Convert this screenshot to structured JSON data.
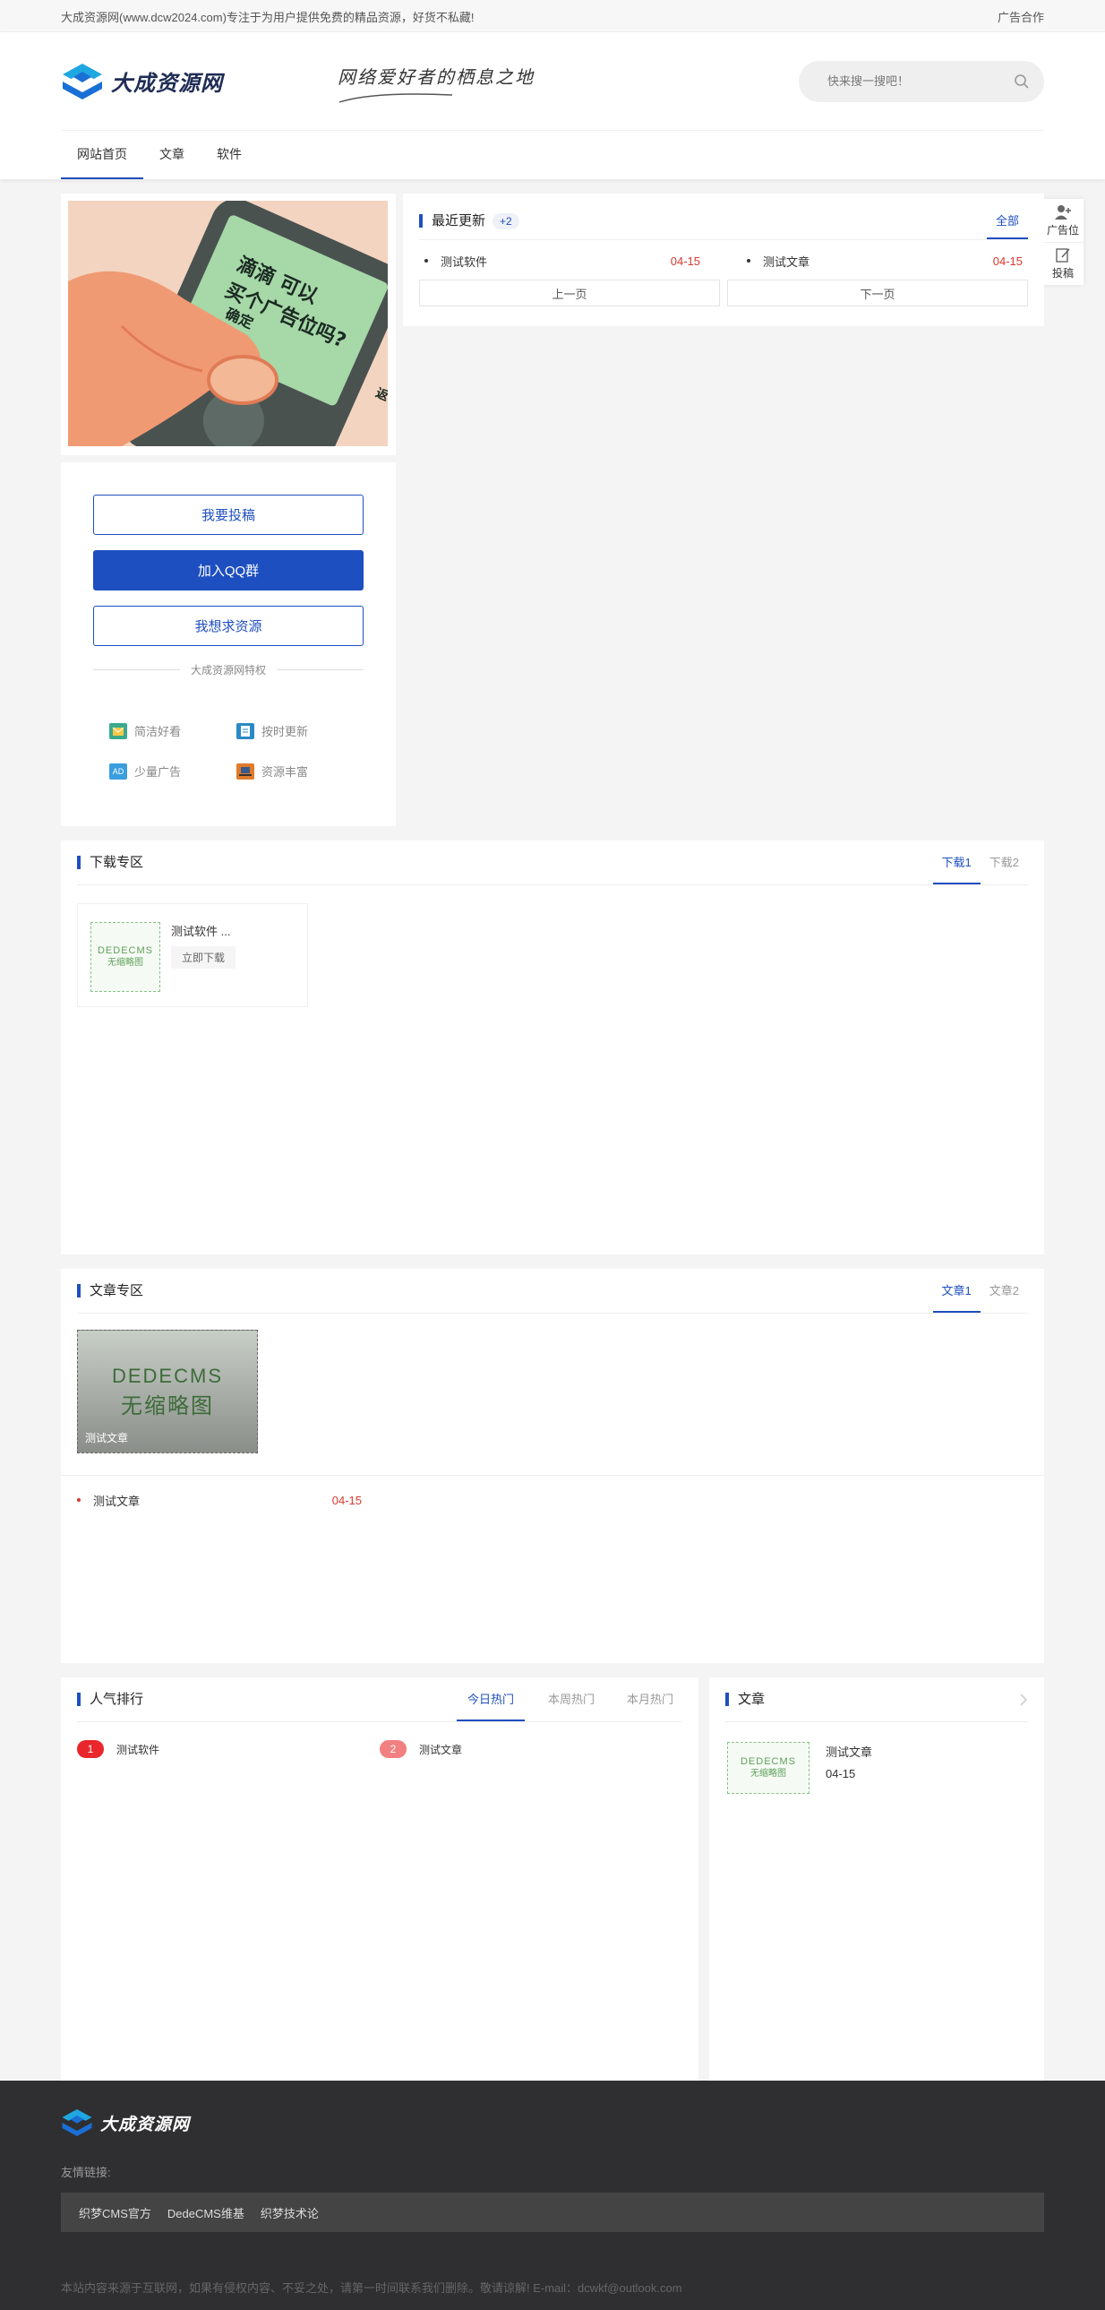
{
  "topbar": {
    "intro": "大成资源网(www.dcw2024.com)专注于为用户提供免费的精品资源，好货不私藏!",
    "ad_coop": "广告合作"
  },
  "header": {
    "logo_text": "大成资源网",
    "slogan": "网络爱好者的栖息之地",
    "search_placeholder": "快来搜一搜吧！"
  },
  "nav": {
    "items": [
      "网站首页",
      "文章",
      "软件"
    ],
    "active": 0
  },
  "ad_panel": {
    "line1": "滴滴 可以",
    "line2": "买个广告位吗?",
    "confirm": "确定",
    "cancel": "返"
  },
  "actions": {
    "submit": "我要投稿",
    "join_qq": "加入QQ群",
    "request": "我想求资源",
    "privilege_title": "大成资源网特权",
    "features": [
      "简洁好看",
      "按时更新",
      "少量广告",
      "资源丰富"
    ]
  },
  "recent": {
    "title": "最近更新",
    "badge": "+2",
    "all": "全部",
    "items": [
      {
        "title": "测试软件",
        "date": "04-15"
      },
      {
        "title": "测试文章",
        "date": "04-15"
      }
    ],
    "prev": "上一页",
    "next": "下一页"
  },
  "float": {
    "ad_slot": "广告位",
    "contribute": "投稿"
  },
  "download": {
    "title": "下载专区",
    "tabs": [
      "下载1",
      "下载2"
    ],
    "card": {
      "title": "测试软件 ...",
      "btn": "立即下载",
      "thumb_l1": "DEDECMS",
      "thumb_l2": "无缩略图"
    }
  },
  "article": {
    "title": "文章专区",
    "tabs": [
      "文章1",
      "文章2"
    ],
    "card": {
      "t1": "DEDECMS",
      "t2": "无缩略图",
      "caption": "测试文章"
    },
    "list": [
      {
        "title": "测试文章",
        "date": "04-15"
      }
    ]
  },
  "hot": {
    "title": "人气排行",
    "tabs": [
      "今日热门",
      "本周热门",
      "本月热门"
    ],
    "items": [
      {
        "rank": "1",
        "title": "测试软件"
      },
      {
        "rank": "2",
        "title": "测试文章"
      }
    ]
  },
  "side_article": {
    "title": "文章",
    "item": {
      "title": "测试文章",
      "date": "04-15",
      "thumb_l1": "DEDECMS",
      "thumb_l2": "无缩略图"
    }
  },
  "footer": {
    "logo_text": "大成资源网",
    "friend_title": "友情链接:",
    "links": [
      "织梦CMS官方",
      "DedeCMS维基",
      "织梦技术论"
    ],
    "copyright": "本站内容来源于互联网，如果有侵权内容、不妥之处，请第一时间联系我们删除。敬请谅解! E-mail：dcwkf@outlook.com"
  },
  "colors": {
    "brand": "#1f4fbf",
    "date_red": "#d63a2f",
    "footer_bg": "#2f2f31"
  }
}
